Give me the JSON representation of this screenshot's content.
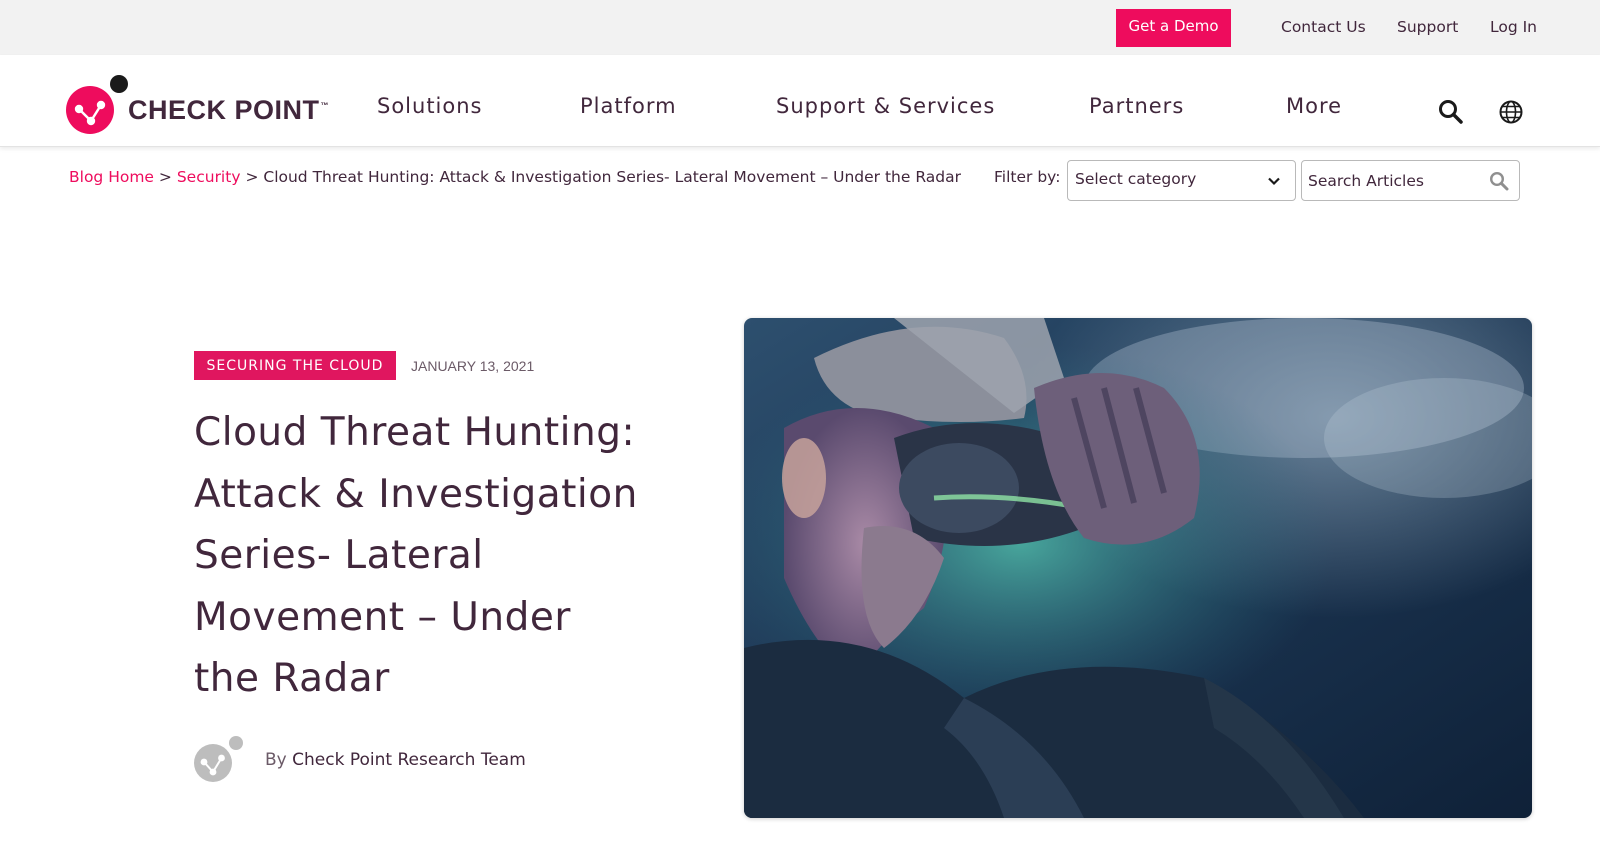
{
  "utility": {
    "demo_label": "Get a Demo",
    "links": [
      "Contact Us",
      "Support",
      "Log In"
    ]
  },
  "logo": {
    "text": "CHECK POINT",
    "tm": "™"
  },
  "nav": {
    "items": [
      "Solutions",
      "Platform",
      "Support & Services",
      "Partners",
      "More"
    ],
    "icons": [
      "search-icon",
      "globe-icon"
    ]
  },
  "breadcrumb": {
    "home": "Blog Home",
    "sep": ">",
    "category": "Security",
    "current": "Cloud Threat Hunting: Attack & Investigation Series- Lateral Movement – Under the Radar"
  },
  "filter": {
    "label": "Filter by:",
    "select_value": "Select category",
    "search_placeholder": "Search Articles"
  },
  "article": {
    "tag": "SECURING THE CLOUD",
    "date": "JANUARY 13, 2021",
    "title": "Cloud Threat Hunting: Attack & Investigation Series- Lateral Movement – Under the Radar",
    "author_prefix": "By",
    "author": "Check Point Research Team"
  },
  "colors": {
    "brand": "#ee0c5d",
    "text": "#41273c",
    "utility_bg": "#f2f2f2"
  }
}
